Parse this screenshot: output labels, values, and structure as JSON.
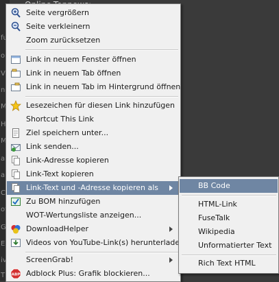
{
  "background": {
    "top_text": "Online-Topnews:",
    "side_fragments": [
      "fu",
      "ol",
      "V",
      "nl",
      "M",
      "Hi",
      "M",
      "a",
      "al",
      "CS",
      "ov",
      "G",
      "E",
      "iv",
      "TP"
    ]
  },
  "context_menu": {
    "items": [
      {
        "label": "Seite vergrößern",
        "icon": "zoom-in-icon"
      },
      {
        "label": "Seite verkleinern",
        "icon": "zoom-out-icon"
      },
      {
        "label": "Zoom zurücksetzen",
        "icon": ""
      },
      {
        "label": "Link in neuem Fenster öffnen",
        "icon": "new-window-icon"
      },
      {
        "label": "Link in neuem Tab öffnen",
        "icon": "new-tab-icon"
      },
      {
        "label": "Link in neuem Tab im Hintergrund öffnen",
        "icon": "background-tab-icon"
      },
      {
        "label": "Lesezeichen für diesen Link hinzufügen",
        "icon": "star-icon"
      },
      {
        "label": "Shortcut This Link",
        "icon": ""
      },
      {
        "label": "Ziel speichern unter...",
        "icon": "save-icon"
      },
      {
        "label": "Link senden...",
        "icon": "send-link-icon"
      },
      {
        "label": "Link-Adresse kopieren",
        "icon": "copy-icon"
      },
      {
        "label": "Link-Text kopieren",
        "icon": "copy-icon"
      },
      {
        "label": "Link-Text und -Adresse kopieren als",
        "icon": "copy-icon"
      },
      {
        "label": "Zu BOM hinzufügen",
        "icon": "bom-icon"
      },
      {
        "label": "WOT-Wertungsliste anzeigen...",
        "icon": ""
      },
      {
        "label": "DownloadHelper",
        "icon": "downloadhelper-icon"
      },
      {
        "label": "Videos von YouTube-Link(s) herunterladen",
        "icon": "video-download-icon"
      },
      {
        "label": "ScreenGrab!",
        "icon": ""
      },
      {
        "label": "Adblock Plus: Grafik blockieren...",
        "icon": "adblock-icon"
      }
    ],
    "adblock_badge": "ABP"
  },
  "submenu": {
    "items": [
      "BB Code",
      "HTML-Link",
      "FuseTalk",
      "Wikipedia",
      "Unformatierter Text",
      "Rich Text HTML"
    ]
  },
  "colors": {
    "highlight": "#6f86a3",
    "menu_bg": "#f0f0f0"
  }
}
